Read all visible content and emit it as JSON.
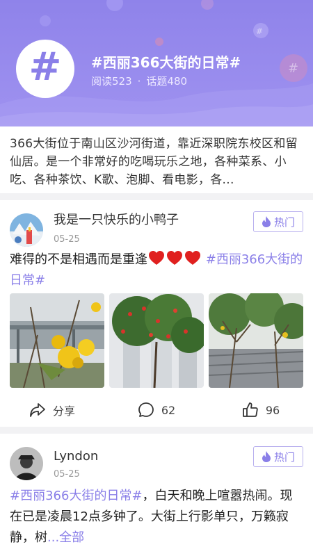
{
  "topic": {
    "icon": "hash-icon",
    "icon_glyph": "#",
    "title": "#西丽366大街的日常#",
    "reads": "阅读523",
    "separator": "·",
    "topics": "话题480",
    "description": "366大街位于南山区沙河街道，靠近深职院东校区和留仙居。是一个非常好的吃喝玩乐之地，各种菜系、小吃、各种茶饮、K歌、泡脚、看电影，各..."
  },
  "posts": [
    {
      "username": "我是一只快乐的小鸭子",
      "date": "05-25",
      "hot_label": "热门",
      "text": "难得的不是相遇而是重逢",
      "hearts": [
        "heart-emoji",
        "heart-emoji",
        "heart-emoji"
      ],
      "tag": "#西丽366大街的日常#",
      "photos": [
        "yellow-flowers-photo",
        "red-flower-tree-photo",
        "tree-lined-road-photo"
      ],
      "share_label": "分享",
      "comments": "62",
      "likes": "96"
    },
    {
      "username": "Lyndon",
      "date": "05-25",
      "hot_label": "热门",
      "tag": "#西丽366大街的日常#",
      "text": "，白天和晚上喧嚣热闹。现在已是凌晨12点多钟了。大街上行影单只，万籁寂静，树",
      "more": "...全部"
    }
  ],
  "colors": {
    "accent": "#8a7fe8",
    "header": "#9488ec",
    "heart": "#e0201f"
  }
}
